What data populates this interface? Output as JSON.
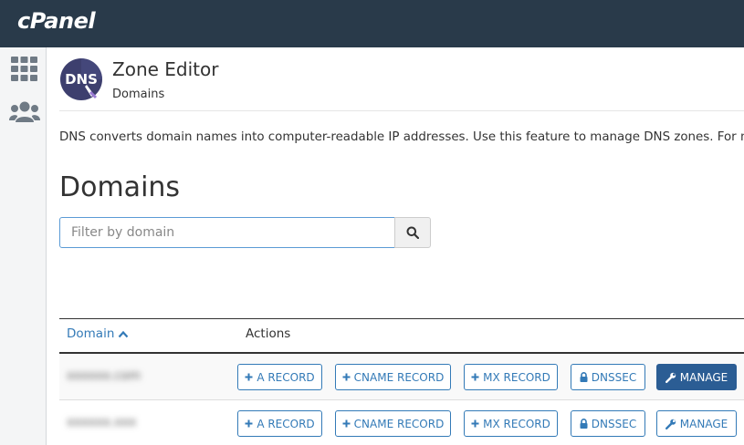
{
  "brand": {
    "logo_text": "cPanel"
  },
  "header": {
    "title": "Zone Editor",
    "breadcrumb": "Domains",
    "app_icon_label": "DNS"
  },
  "description": "DNS converts domain names into computer-readable IP addresses. Use this feature to manage DNS zones. For more",
  "section": {
    "title": "Domains"
  },
  "search": {
    "placeholder": "Filter by domain",
    "value": ""
  },
  "table": {
    "columns": {
      "domain": "Domain",
      "actions": "Actions"
    },
    "rows": [
      {
        "domain": "xxxxxx.com",
        "buttons": {
          "a_record": "A RECORD",
          "cname_record": "CNAME RECORD",
          "mx_record": "MX RECORD",
          "dnssec": "DNSSEC",
          "manage": "MANAGE"
        }
      },
      {
        "domain": "xxxxxx.xxx",
        "buttons": {
          "a_record": "A RECORD",
          "cname_record": "CNAME RECORD",
          "mx_record": "MX RECORD",
          "dnssec": "DNSSEC",
          "manage": "MANAGE"
        }
      }
    ]
  },
  "colors": {
    "topbar": "#293a4a",
    "link": "#337ab7",
    "primary_button": "#2b5d94"
  },
  "icons": {
    "sidebar": [
      "grid-icon",
      "users-icon"
    ],
    "search": "search-icon",
    "sort": "chevron-up-icon",
    "add": "plus-icon",
    "lock": "lock-icon",
    "wrench": "wrench-icon"
  }
}
